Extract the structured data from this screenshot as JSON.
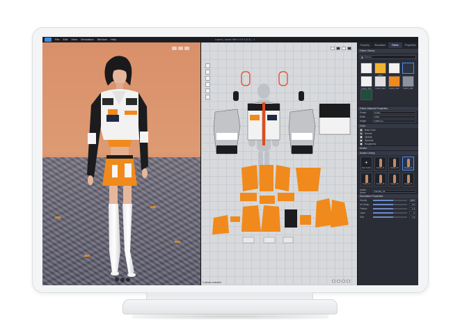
{
  "window": {
    "title": "Layers | Jacket Skirt 1.0.0.0 (0.3) – 1",
    "menu": [
      "File",
      "Edit",
      "View",
      "Simulation",
      "Window",
      "Help"
    ]
  },
  "panel": {
    "tabs": [
      "Property",
      "Simulation",
      "Fabric",
      "Properties"
    ],
    "active_tab": 2,
    "library_title": "Fabric Library",
    "search_placeholder": "Search...",
    "fabrics": [
      {
        "label": "",
        "color": "#f1f1f1"
      },
      {
        "label": "Fabric",
        "color": "#f2b233"
      },
      {
        "label": "",
        "color": "#f1f1f1"
      },
      {
        "label": "",
        "color": "#2c3342"
      },
      {
        "label": "Fabric_001",
        "color": "#f2f2f2"
      },
      {
        "label": "Fabric_002",
        "color": "#dedede"
      },
      {
        "label": "Fabric_003",
        "color": "#f08a1c"
      },
      {
        "label": "Fabric_004",
        "color": "#8c939e"
      },
      {
        "label": "",
        "color": "#1f4e3a"
      }
    ],
    "properties_title": "Fabric Material Properties",
    "props": [
      {
        "label": "Preset",
        "value": "Cotton"
      },
      {
        "label": "Width",
        "value": "1700"
      },
      {
        "label": "Height",
        "value": "1700 mm"
      }
    ],
    "colors_title": "Color",
    "color_layers": [
      {
        "label": "Base Color",
        "color": "#d8d8d8"
      },
      {
        "label": "Normal",
        "color": "#8f84f0"
      },
      {
        "label": "Opacity",
        "color": "#ffffff"
      },
      {
        "label": "Specular",
        "color": "#d6d6d6"
      },
      {
        "label": "Roughness",
        "color": "#eaeaea"
      }
    ],
    "avatar_section": "Avatar",
    "avatar_library": "Avatar Library",
    "avatars": [
      {
        "label": "New Folder"
      },
      {
        "label": "Avatar_01"
      },
      {
        "label": "Avatar_02"
      },
      {
        "label": "Avatar_03"
      },
      {
        "label": "Avatar_04"
      },
      {
        "label": "Avatar_05"
      },
      {
        "label": "Avatar_06"
      },
      {
        "label": "Avatar_07"
      }
    ],
    "avatar_name_label": "Avatar Name",
    "avatar_name": "Female_V2",
    "sim_title": "Simulation Properties",
    "sim_rows": [
      {
        "label": "Gravity",
        "value": "-9800"
      },
      {
        "label": "Air Damp",
        "value": "0.5"
      },
      {
        "label": "Friction",
        "value": "0.3"
      },
      {
        "label": "Layer",
        "value": "0"
      },
      {
        "label": "Skin",
        "value": "1.0"
      }
    ]
  },
  "view2d": {
    "status": "0 pieces selected"
  },
  "progress": {
    "sim_fill": 0.6
  }
}
